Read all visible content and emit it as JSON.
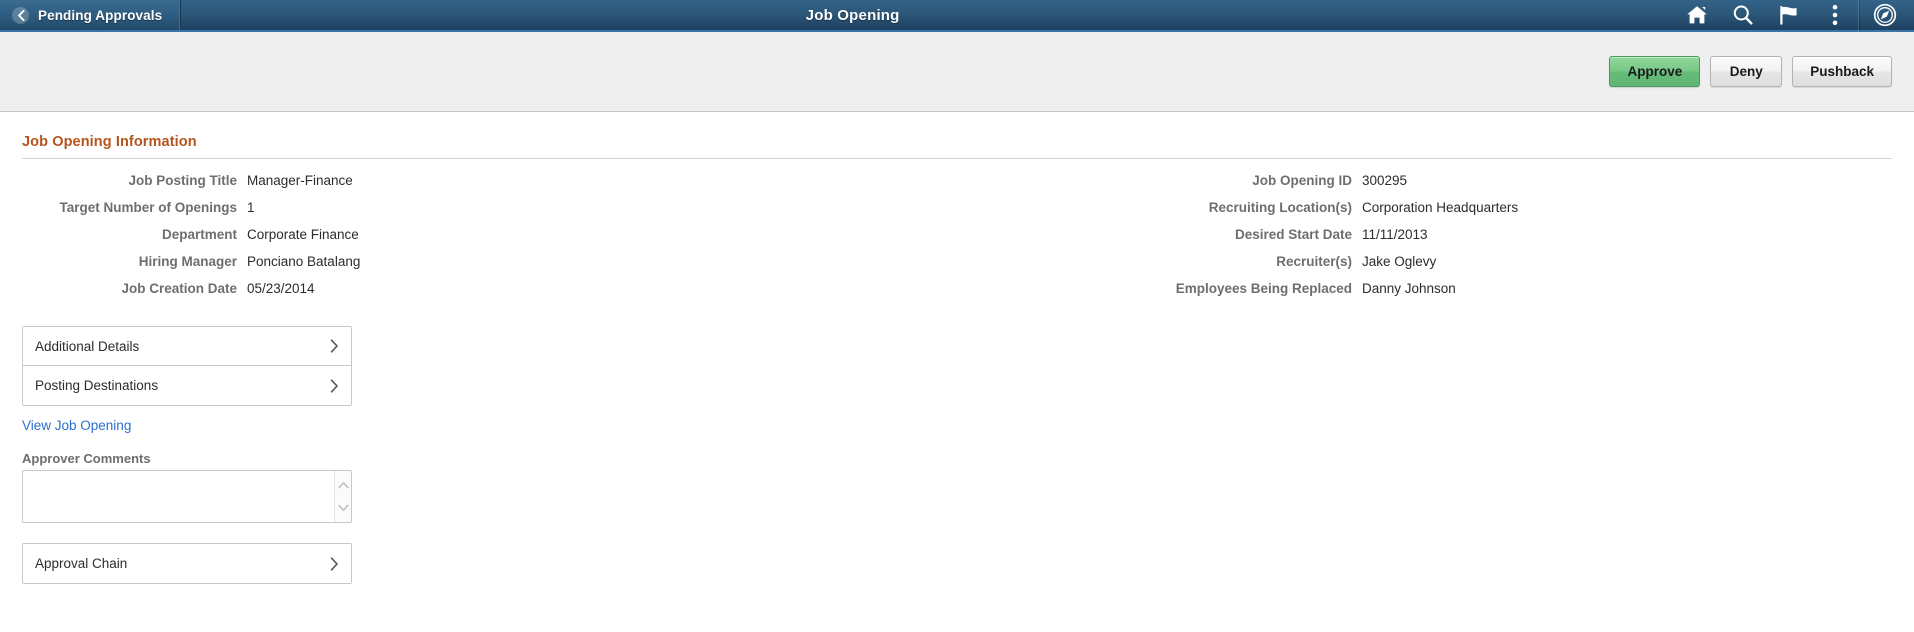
{
  "header": {
    "back_label": "Pending Approvals",
    "title": "Job Opening",
    "icons": [
      {
        "name": "home-icon",
        "label": "Home"
      },
      {
        "name": "search-icon",
        "label": "Search"
      },
      {
        "name": "flag-icon",
        "label": "Notifications"
      },
      {
        "name": "vertical-dots-icon",
        "label": "Actions"
      },
      {
        "name": "navbar-compass-icon",
        "label": "NavBar"
      }
    ],
    "colors": {
      "bar_top": "#336288",
      "bar_bottom": "#1e4060",
      "accent_rule": "#3c74a8"
    }
  },
  "toolbar": {
    "approve_label": "Approve",
    "deny_label": "Deny",
    "pushback_label": "Pushback",
    "approve_color": "#79c888"
  },
  "section": {
    "title": "Job Opening Information",
    "title_color": "#b5541c"
  },
  "fields_left": [
    {
      "label": "Job Posting Title",
      "value": "Manager-Finance"
    },
    {
      "label": "Target Number of Openings",
      "value": "1"
    },
    {
      "label": "Department",
      "value": "Corporate Finance"
    },
    {
      "label": "Hiring Manager",
      "value": "Ponciano Batalang"
    },
    {
      "label": "Job Creation Date",
      "value": "05/23/2014"
    }
  ],
  "fields_right": [
    {
      "label": "Job Opening ID",
      "value": "300295"
    },
    {
      "label": "Recruiting Location(s)",
      "value": "Corporation Headquarters"
    },
    {
      "label": "Desired Start Date",
      "value": "11/11/2013"
    },
    {
      "label": "Recruiter(s)",
      "value": "Jake Oglevy"
    },
    {
      "label": "Employees Being Replaced",
      "value": "Danny Johnson"
    }
  ],
  "detail_panels": [
    {
      "label": "Additional Details"
    },
    {
      "label": "Posting Destinations"
    }
  ],
  "view_link": {
    "label": "View Job Opening"
  },
  "comments": {
    "label": "Approver Comments",
    "value": "",
    "placeholder": ""
  },
  "approval_chain": {
    "label": "Approval Chain"
  }
}
